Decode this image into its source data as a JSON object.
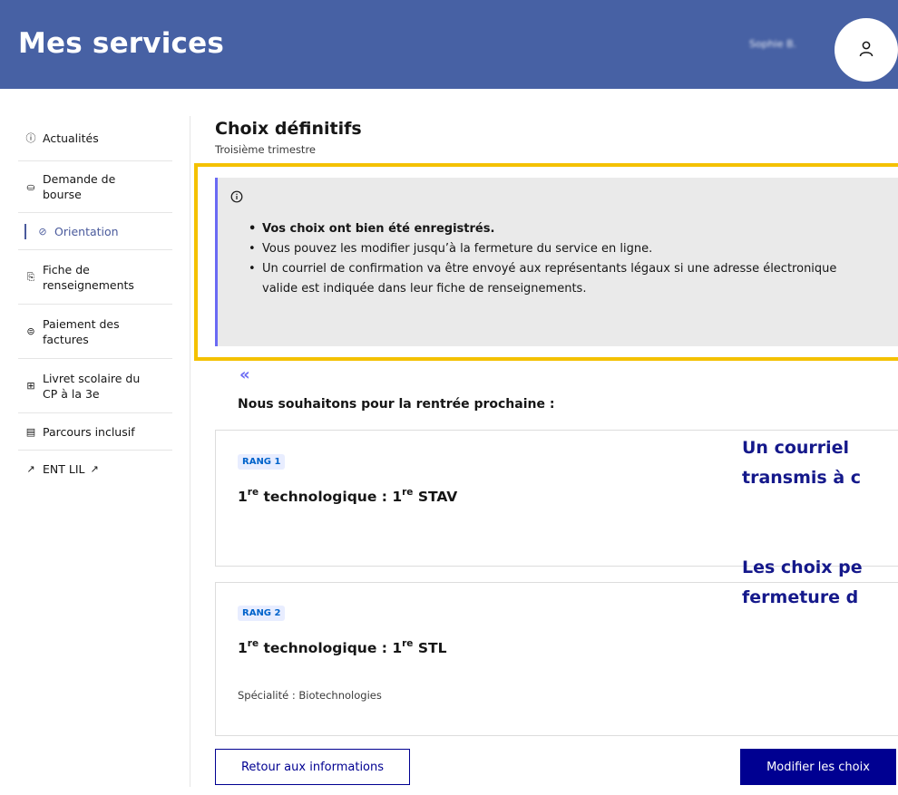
{
  "header": {
    "title": "Mes services",
    "user_name": "Sophie B."
  },
  "sidebar": {
    "items": [
      {
        "label": "Actualités",
        "icon": "info-circle-icon",
        "glyph": "ⓘ",
        "active": false
      },
      {
        "label": "Demande de bourse",
        "icon": "hand-coins-icon",
        "glyph": "⛀",
        "active": false
      },
      {
        "label": "Orientation",
        "icon": "compass-icon",
        "glyph": "⊘",
        "active": true
      },
      {
        "label": "Fiche de renseignements",
        "icon": "edit-document-icon",
        "glyph": "⎘",
        "active": false
      },
      {
        "label": "Paiement des factures",
        "icon": "coin-icon",
        "glyph": "⊜",
        "active": false
      },
      {
        "label": "Livret scolaire du CP à la 3e",
        "icon": "open-book-icon",
        "glyph": "⊞",
        "active": false
      },
      {
        "label": "Parcours inclusif",
        "icon": "calendar-icon",
        "glyph": "▤",
        "active": false
      },
      {
        "label": "ENT LIL",
        "icon": "external-link-icon",
        "glyph": "↗",
        "active": false
      }
    ]
  },
  "main": {
    "title": "Choix définitifs",
    "subtitle": "Troisième trimestre",
    "notice": {
      "items": [
        "Vos choix ont bien été enregistrés.",
        "Vous pouvez les modifier jusqu’à la fermeture du service en ligne.",
        "Un courriel de confirmation va être envoyé aux représentants légaux si une adresse électronique valide est indiquée dans leur fiche de renseignements."
      ]
    },
    "intro": "Nous souhaitons pour la rentrée prochaine :",
    "choices": [
      {
        "rank": "RANG 1",
        "prefix": "1",
        "prefix_sup": "re",
        "label_mid": " technologique : 1",
        "label_sup": "re",
        "label_end": " STAV",
        "specialty": ""
      },
      {
        "rank": "RANG 2",
        "prefix": "1",
        "prefix_sup": "re",
        "label_mid": " technologique : 1",
        "label_sup": "re",
        "label_end": " STL",
        "specialty": "Spécialité : Biotechnologies"
      }
    ],
    "back_button": "Retour aux informations",
    "modify_button": "Modifier les choix"
  },
  "overlay": {
    "line1": "Un courriel",
    "line2": "transmis à c",
    "line3": "Les choix pe",
    "line4": "fermeture d"
  },
  "colors": {
    "header_bg": "#4761a4",
    "notice_accent": "#6a6af4",
    "highlight": "#f4c100",
    "primary": "#000091",
    "overlay_text": "#15198b"
  }
}
